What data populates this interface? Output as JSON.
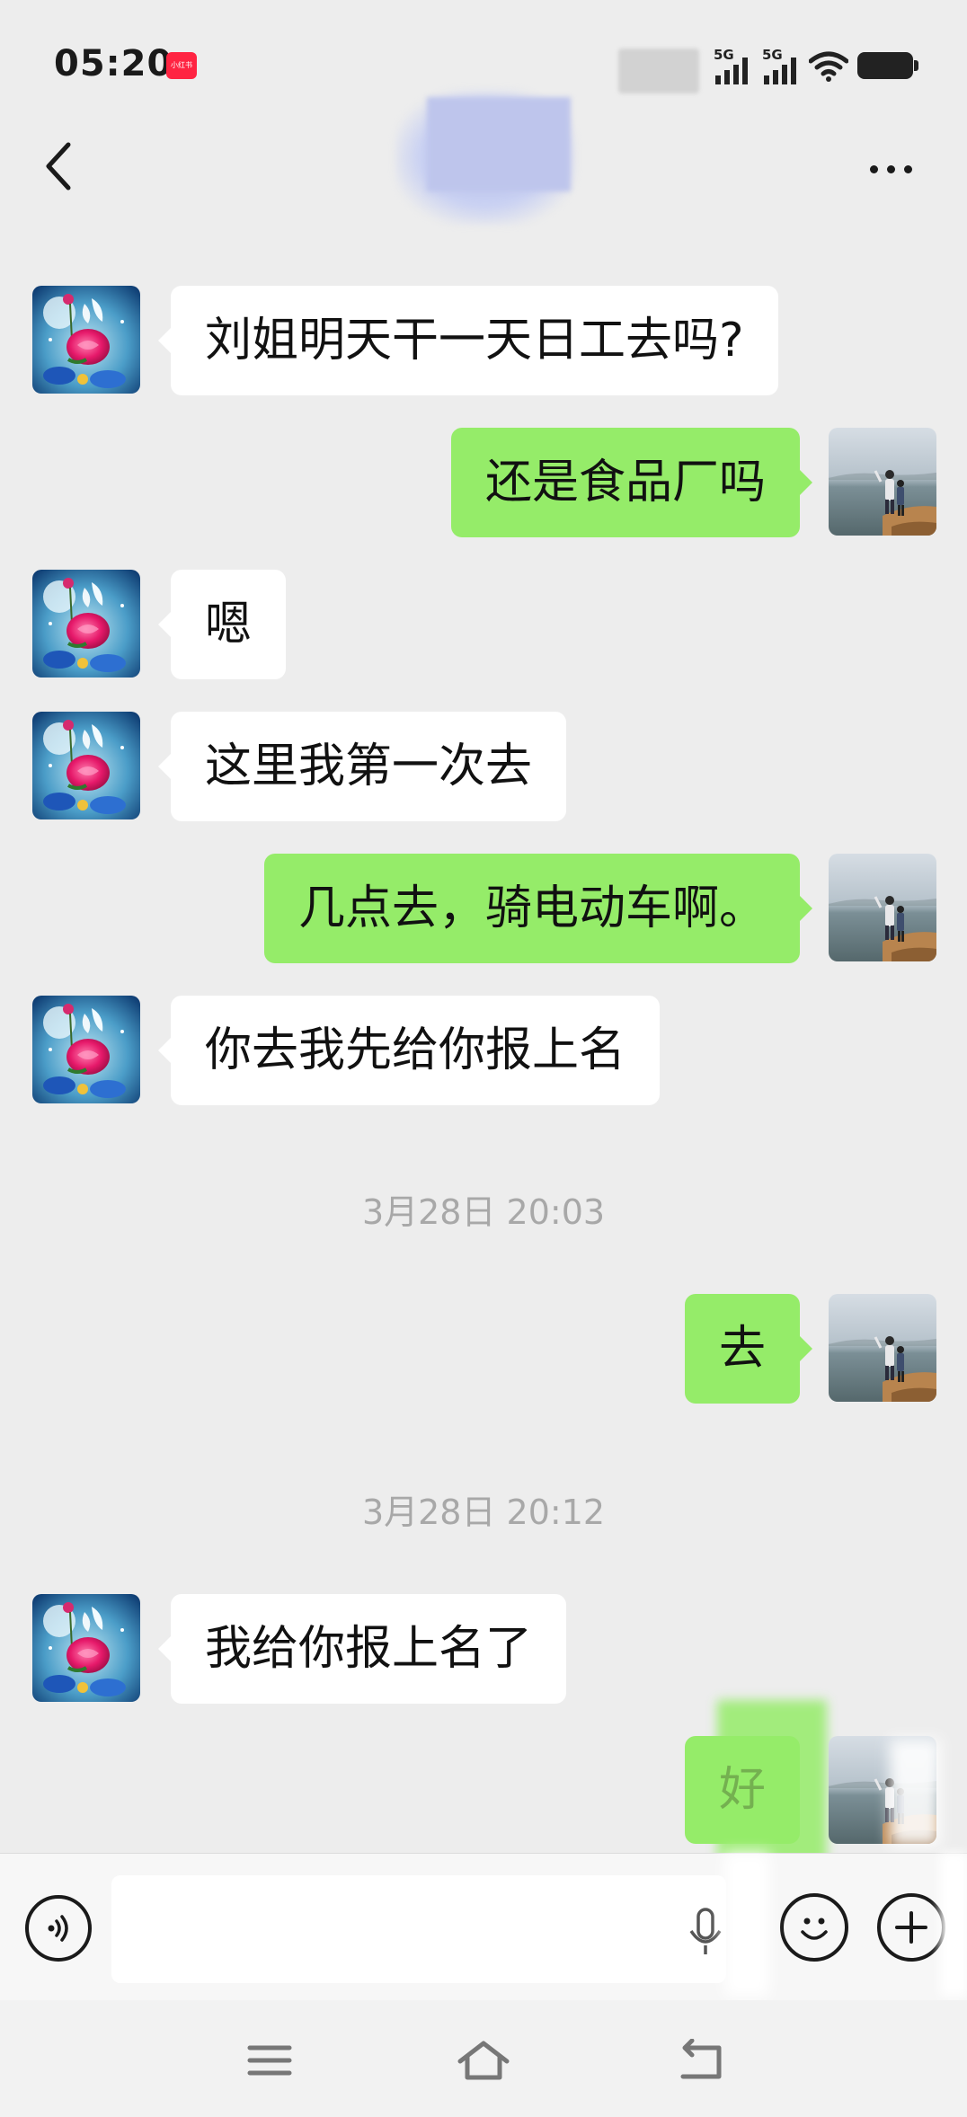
{
  "status_bar": {
    "time": "05:20",
    "app_badge": "小红书",
    "network_1": "5G",
    "network_2": "5G"
  },
  "header": {
    "back_icon": "chevron-left-icon",
    "more_icon": "more-dots-icon"
  },
  "messages": [
    {
      "side": "left",
      "text": "刘姐明天干一天日工去吗?"
    },
    {
      "side": "right",
      "text": "还是食品厂吗"
    },
    {
      "side": "left",
      "text": "嗯"
    },
    {
      "side": "left",
      "text": "这里我第一次去"
    },
    {
      "side": "right",
      "text": "几点去，骑电动车啊。"
    },
    {
      "side": "left",
      "text": "你去我先给你报上名"
    },
    {
      "side": "time",
      "text": "3月28日 20:03"
    },
    {
      "side": "right",
      "text": "去"
    },
    {
      "side": "time",
      "text": "3月28日 20:12"
    },
    {
      "side": "left",
      "text": "我给你报上名了"
    },
    {
      "side": "right",
      "text": "好"
    }
  ],
  "input_bar": {
    "voice_icon": "voice-toggle-icon",
    "text_value": "",
    "mic_icon": "microphone-icon",
    "emoji_icon": "emoji-icon",
    "plus_icon": "plus-icon"
  },
  "nav_bar": {
    "menu_icon": "menu-icon",
    "home_icon": "home-icon",
    "back_icon": "back-icon"
  },
  "colors": {
    "background": "#ededed",
    "sent_bubble": "#95ec69",
    "received_bubble": "#ffffff",
    "timestamp": "#a8a8a8"
  }
}
